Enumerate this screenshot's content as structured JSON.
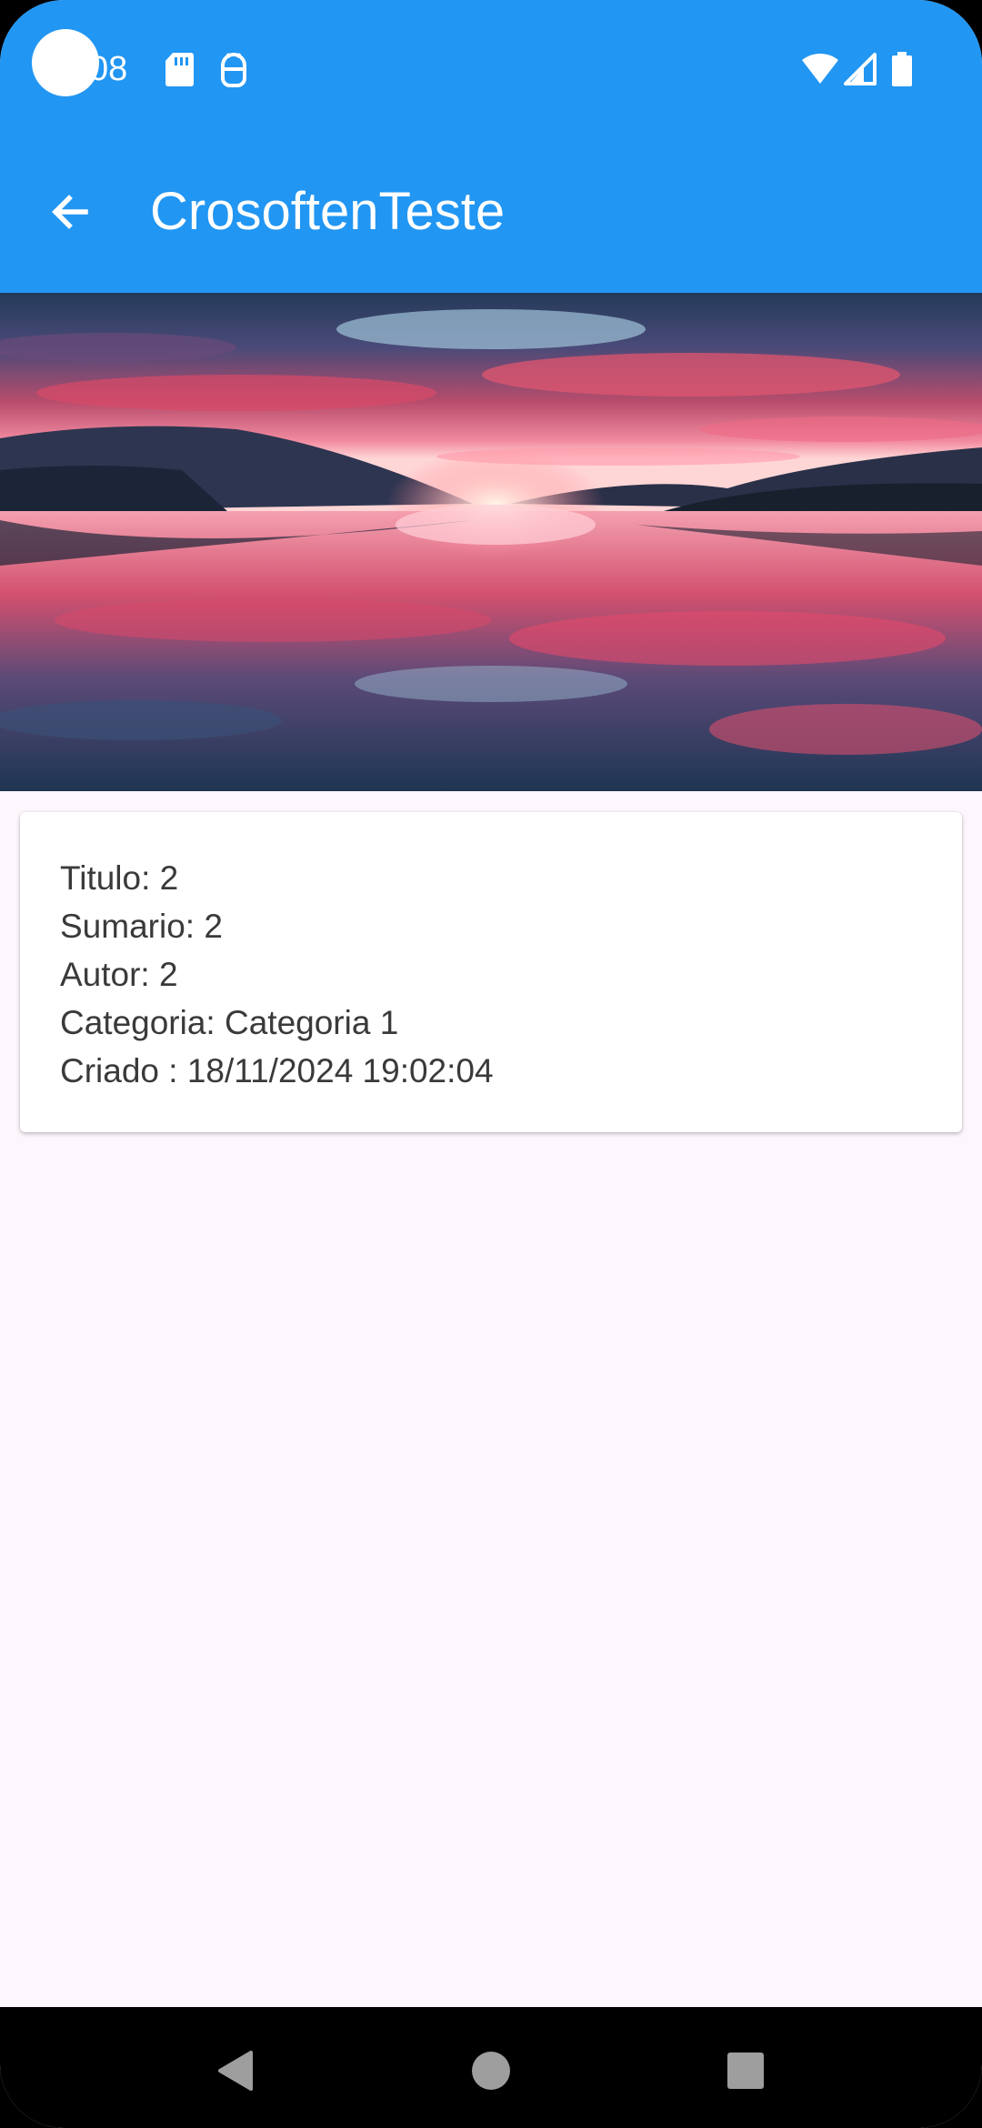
{
  "status_bar": {
    "time": "08",
    "icons": [
      "sd-card-icon",
      "android-debug-icon",
      "wifi-icon",
      "cell-signal-icon",
      "battery-icon"
    ]
  },
  "app_bar": {
    "title": "CrosoftenTeste",
    "back_icon": "arrow-back-icon"
  },
  "hero": {
    "description_icon": "landscape-image"
  },
  "details": {
    "titulo": "Titulo: 2",
    "sumario": "Sumario: 2",
    "autor": "Autor: 2",
    "categoria": "Categoria: Categoria 1",
    "criado": "Criado : 18/11/2024 19:02:04"
  },
  "nav": {
    "icons": [
      "nav-back-icon",
      "nav-home-icon",
      "nav-recents-icon"
    ]
  },
  "colors": {
    "primary": "#2196f3",
    "background": "#fdf6fd",
    "card": "#ffffff",
    "text": "#3a3a3a"
  }
}
